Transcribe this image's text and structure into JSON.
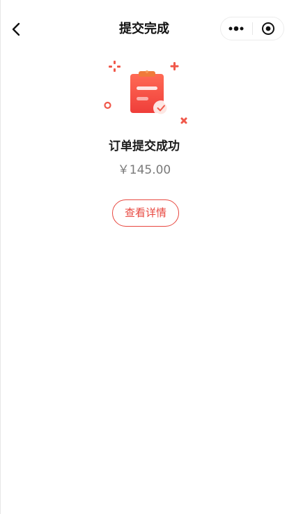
{
  "navbar": {
    "title": "提交完成",
    "back_icon": "chevron-left-icon",
    "more_icon": "more-dots-icon",
    "close_icon": "target-circle-icon"
  },
  "result": {
    "icon": "clipboard-check-icon",
    "title": "订单提交成功",
    "amount": "￥145.00"
  },
  "actions": {
    "detail_label": "查看详情"
  },
  "colors": {
    "accent": "#e8473f",
    "title_text": "#1a1a1a",
    "amount_text": "#7a7a7a"
  }
}
